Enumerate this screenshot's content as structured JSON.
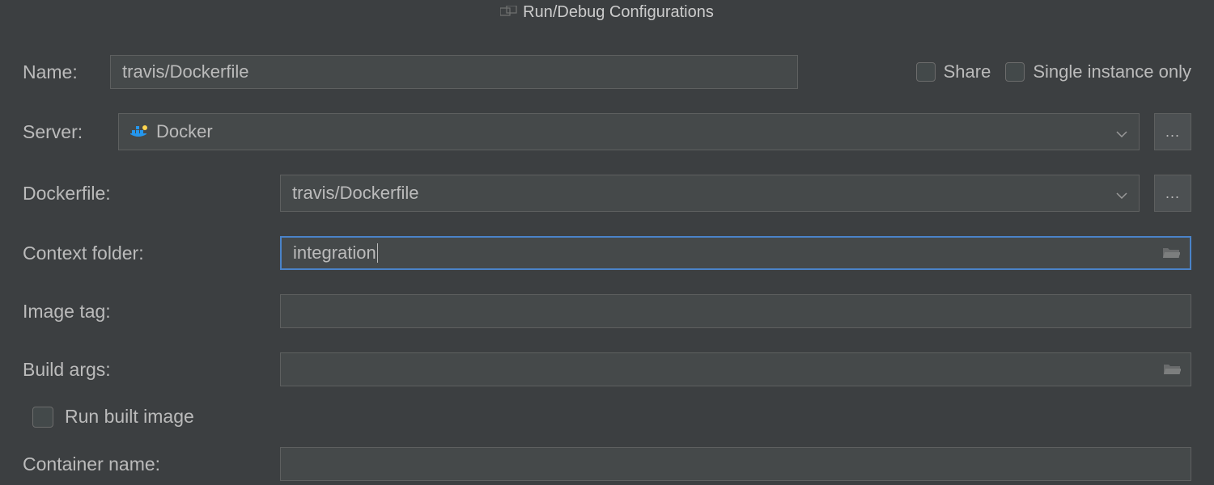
{
  "title": "Run/Debug Configurations",
  "form": {
    "name_label": "Name:",
    "name_value": "travis/Dockerfile",
    "share_label": "Share",
    "single_instance_label": "Single instance only",
    "server_label": "Server:",
    "server_value": "Docker",
    "dockerfile_label": "Dockerfile:",
    "dockerfile_value": "travis/Dockerfile",
    "context_folder_label": "Context folder:",
    "context_folder_value": "integration",
    "image_tag_label": "Image tag:",
    "image_tag_value": "",
    "build_args_label": "Build args:",
    "build_args_value": "",
    "run_built_image_label": "Run built image",
    "container_name_label": "Container name:",
    "container_name_value": ""
  },
  "icons": {
    "more": "...",
    "docker": "docker-icon",
    "folder": "folder-icon",
    "chevron": "chevron-down-icon",
    "title": "windows-icon"
  }
}
